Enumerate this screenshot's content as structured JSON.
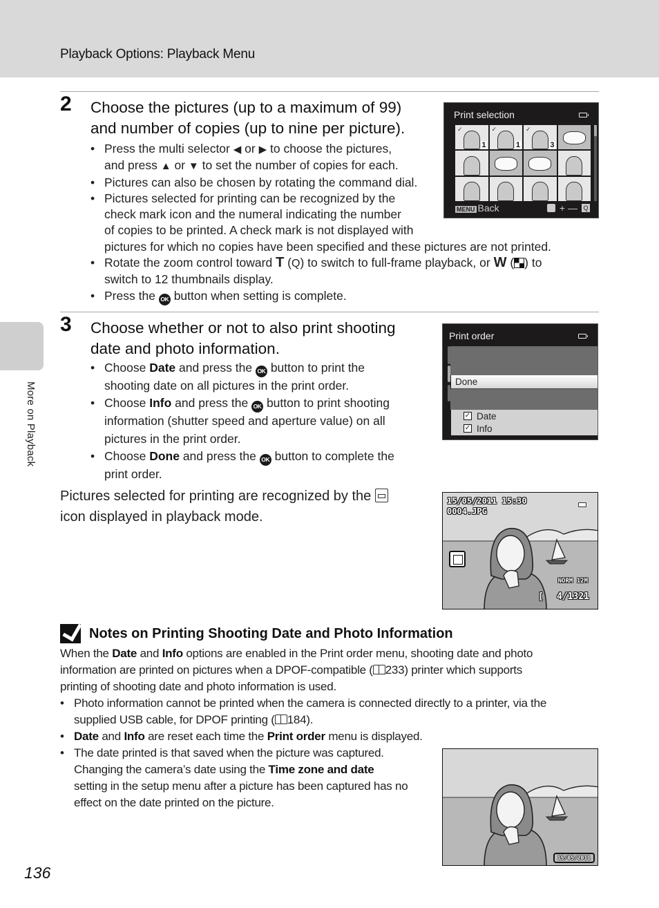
{
  "header": {
    "title": "Playback Options: Playback Menu"
  },
  "side_tab": {
    "label": "More on Playback"
  },
  "page_number": "136",
  "step2": {
    "number": "2",
    "title_line1": "Choose the pictures (up to a maximum of 99)",
    "title_line2": "and number of copies (up to nine per picture).",
    "bullets": {
      "b1_a": "Press the multi selector",
      "b1_left": "◀",
      "b1_or1": "or",
      "b1_right": "▶",
      "b1_b": "to choose the pictures,",
      "b1_c": "and press",
      "b1_up": "▲",
      "b1_or2": "or",
      "b1_down": "▼",
      "b1_d": "to set the number of copies for each.",
      "b2": "Pictures can also be chosen by rotating the command dial.",
      "b3_l1": "Pictures selected for printing can be recognized by the",
      "b3_l2": "check mark icon and the numeral indicating the number",
      "b3_l3": "of copies to be printed. A check mark is not displayed with",
      "b3_l4": "pictures for which no copies have been specified and these pictures are not printed.",
      "b4_a": "Rotate the zoom control toward",
      "b4_T": "T",
      "b4_b": "to switch to full-frame playback, or",
      "b4_W": "W",
      "b4_c": "to",
      "b4_l2": "switch to 12 thumbnails display.",
      "b5_a": "Press the",
      "b5_b": "button when setting is complete."
    },
    "ok_glyph": "OK",
    "magnify_glyph": "Q"
  },
  "print_selection_screen": {
    "title": "Print selection",
    "thumbnails": [
      {
        "kind": "portrait",
        "checked": true,
        "copies": "1"
      },
      {
        "kind": "portrait",
        "checked": true,
        "copies": "1"
      },
      {
        "kind": "portrait",
        "checked": true,
        "copies": "3"
      },
      {
        "kind": "flower",
        "checked": false,
        "copies": ""
      },
      {
        "kind": "portrait",
        "checked": false,
        "copies": ""
      },
      {
        "kind": "flower",
        "checked": false,
        "copies": ""
      },
      {
        "kind": "flower",
        "checked": false,
        "copies": ""
      },
      {
        "kind": "portrait",
        "checked": false,
        "copies": ""
      },
      {
        "kind": "portrait",
        "checked": false,
        "copies": ""
      },
      {
        "kind": "portrait",
        "checked": false,
        "copies": ""
      },
      {
        "kind": "portrait",
        "checked": false,
        "copies": ""
      },
      {
        "kind": "portrait",
        "checked": false,
        "copies": ""
      }
    ],
    "check_glyph": "✓",
    "footer_menu_tag": "MENU",
    "footer_back": "Back",
    "footer_plus_minus": "+ —",
    "footer_zoom": "Q"
  },
  "step3": {
    "number": "3",
    "title_line1": "Choose whether or not to also print shooting",
    "title_line2": "date and photo information.",
    "bullets": {
      "b1_a": "Choose",
      "b1_bold": "Date",
      "b1_b": "and press the",
      "b1_c": "button to print the",
      "b1_l2": "shooting date on all pictures in the print order.",
      "b2_a": "Choose",
      "b2_bold": "Info",
      "b2_b": "and press the",
      "b2_c": "button to print shooting",
      "b2_l2": "information (shutter speed and aperture value) on all",
      "b2_l3": "pictures in the print order.",
      "b3_a": "Choose",
      "b3_bold": "Done",
      "b3_b": "and press the",
      "b3_c": "button to complete the",
      "b3_l2": "print order."
    }
  },
  "print_order_screen": {
    "title": "Print order",
    "done_label": "Done",
    "options": [
      {
        "label": "Date",
        "checked": true
      },
      {
        "label": "Info",
        "checked": true
      }
    ],
    "check_glyph": "✓"
  },
  "recognized_paragraph": {
    "line1": "Pictures selected for printing are recognized by the",
    "line2": "icon displayed in playback mode."
  },
  "playback_screen": {
    "datetime": "15/05/2011  15:30",
    "filename": "0004.JPG",
    "image_mode": "NORM 12M",
    "frame_counter": "4/1321",
    "bracket": "["
  },
  "notes": {
    "title": "Notes on Printing Shooting Date and Photo Information",
    "intro": {
      "a": "When the",
      "date": "Date",
      "and": "and",
      "info": "Info",
      "b": "options are enabled in the Print order menu, shooting date and photo",
      "l2_a": "information are printed on pictures when a DPOF-compatible (",
      "l2_ref": "233",
      "l2_b": ") printer which supports",
      "l3": "printing of shooting date and photo information is used."
    },
    "bullet1": {
      "l1": "Photo information cannot be printed when the camera is connected directly to a printer, via the",
      "l2_a": "supplied USB cable, for DPOF printing (",
      "l2_ref": "184",
      "l2_b": ")."
    },
    "bullet2": {
      "date": "Date",
      "and": "and",
      "info": "Info",
      "a": "are reset each time the",
      "print_order": "Print order",
      "b": "menu is displayed."
    },
    "bullet3": {
      "l1": "The date printed is that saved when the picture was captured.",
      "l2_a": "Changing the camera’s date using the",
      "l2_bold": "Time zone and date",
      "l3": "setting in the setup menu after a picture has been captured has no",
      "l4": "effect on the date printed on the picture."
    }
  },
  "printed_photo": {
    "date_stamp": "15/05/2011"
  }
}
